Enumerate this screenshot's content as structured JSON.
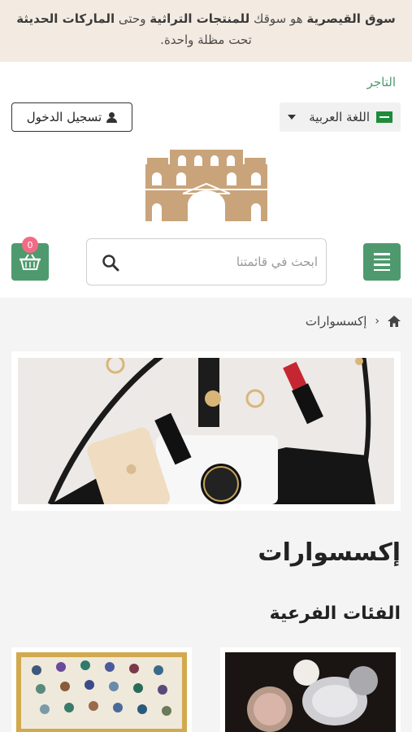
{
  "announcement": {
    "part1": "سوق القيصرية",
    "part2": " هو سوقك ",
    "part3": "للمنتجات التراثية",
    "part4": " وحتى ",
    "part5": "الماركات الحديثة",
    "line2": "تحت مظلة واحدة."
  },
  "header": {
    "merchant_link": "التاجر",
    "language": "اللغة العربية",
    "login_label": "تسجيل الدخول"
  },
  "search": {
    "placeholder": "ابحث في قائمتنا"
  },
  "cart": {
    "count": "0"
  },
  "breadcrumb": {
    "current": "إكسسوارات"
  },
  "category": {
    "title": "إكسسوارات",
    "subcategories_heading": "الفئات الفرعية"
  },
  "colors": {
    "accent_green": "#4e9a6e",
    "announce_bg": "#f3ebe2",
    "badge_pink": "#f26b84",
    "logo_tan": "#c9a47b"
  }
}
